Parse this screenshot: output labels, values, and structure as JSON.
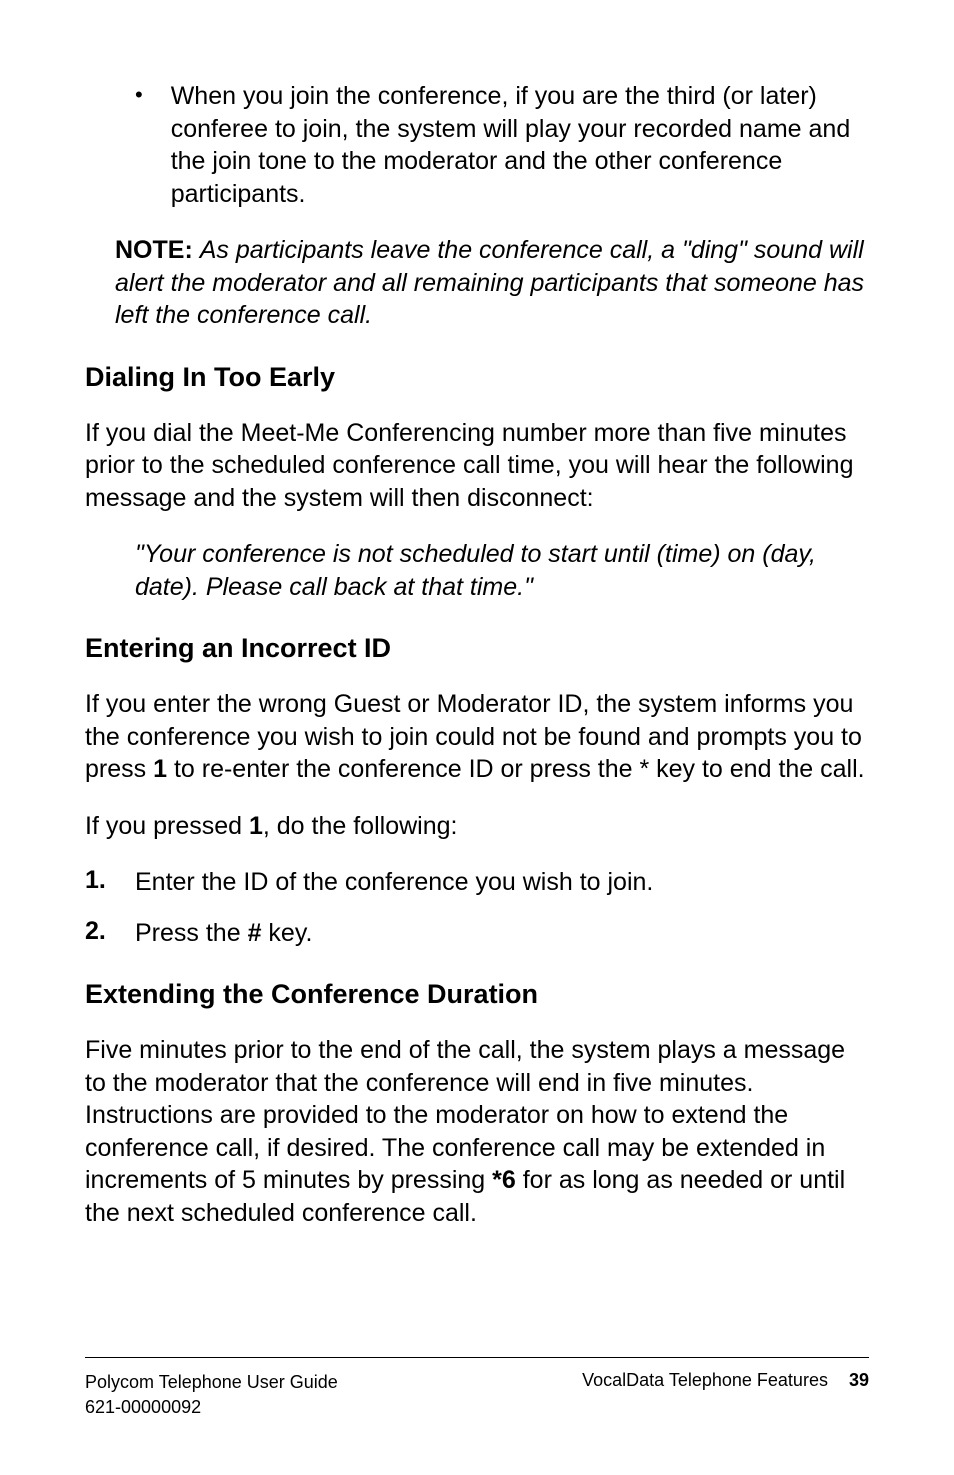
{
  "bullet": {
    "text": "When you join the conference, if you are the third (or later) conferee to join, the system will play your recorded name and the join tone to the moderator and the other conference participants."
  },
  "note": {
    "label": "NOTE:",
    "text": "As participants leave the conference call, a \"ding\" sound will alert the moderator and all remaining participants that someone has left the conference call."
  },
  "section1": {
    "heading": "Dialing In Too Early",
    "body": "If you dial the Meet-Me Conferencing number more than five minutes prior to the scheduled conference call time, you will hear the following message and the system will then disconnect:",
    "quote": "\"Your conference is not scheduled to start until (time) on (day, date). Please call back at that time.\""
  },
  "section2": {
    "heading": "Entering an Incorrect ID",
    "body1_pre": "If you enter the wrong Guest or Moderator ID, the system informs you the conference you wish to join could not be found and prompts you to press ",
    "body1_bold": "1",
    "body1_post": " to re-enter the conference ID or press the * key to end the call.",
    "body2_pre": "If you pressed ",
    "body2_bold": "1",
    "body2_post": ", do the following:",
    "step1_num": "1.",
    "step1_text": "Enter the ID of the conference you wish to join.",
    "step2_num": "2.",
    "step2_pre": "Press the ",
    "step2_bold": "#",
    "step2_post": " key."
  },
  "section3": {
    "heading": "Extending the Conference Duration",
    "body_pre": "Five minutes prior to the end of the call, the system plays a message to the moderator that the conference will end in five minutes. Instructions are provided to the moderator on how to extend the conference call, if desired. The conference call may be extended in increments of 5 minutes by pressing ",
    "body_bold": "*6",
    "body_post": " for as long as needed or until the next scheduled conference call."
  },
  "footer": {
    "left_line1": "Polycom Telephone User Guide",
    "left_line2": "621-00000092",
    "right_text": "VocalData Telephone Features",
    "page": "39"
  }
}
